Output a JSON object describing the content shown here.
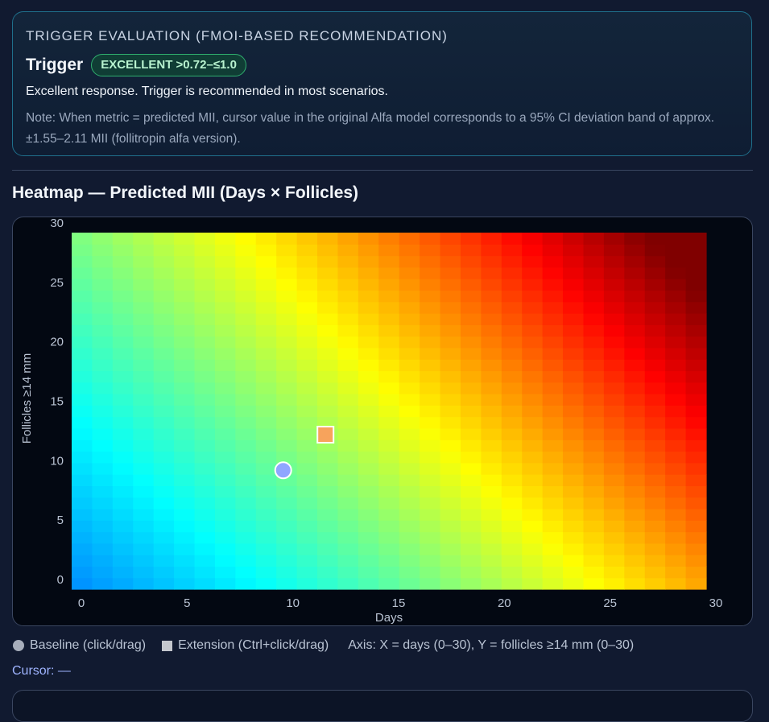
{
  "trigger_card": {
    "heading": "TRIGGER EVALUATION (FMOI-BASED RECOMMENDATION)",
    "title": "Trigger",
    "badge": "EXCELLENT >0.72–≤1.0",
    "description": "Excellent response. Trigger is recommended in most scenarios.",
    "note": "Note: When metric = predicted MII, cursor value in the original Alfa model corresponds to a 95% CI deviation band of approx. ±1.55–2.11 MII (follitropin alfa version)."
  },
  "heatmap": {
    "title": "Heatmap — Predicted MII (Days × Follicles)"
  },
  "chart_data": {
    "type": "heatmap",
    "title": "",
    "xlabel": "Days",
    "ylabel": "Follicles ≥14 mm",
    "xlim": [
      0,
      30
    ],
    "ylim": [
      0,
      30
    ],
    "x_ticks": [
      "0",
      "5",
      "10",
      "15",
      "20",
      "25",
      "30"
    ],
    "y_ticks": [
      "0",
      "5",
      "10",
      "15",
      "20",
      "25",
      "30"
    ],
    "colormap": "jet",
    "grid": false,
    "markers": [
      {
        "name": "Baseline",
        "shape": "circle",
        "x": 10,
        "y": 10,
        "color": "#8fa6ff"
      },
      {
        "name": "Extension",
        "shape": "square",
        "x": 12,
        "y": 13,
        "color": "#f7a35c"
      }
    ]
  },
  "legend": {
    "baseline": "Baseline (click/drag)",
    "extension": "Extension (Ctrl+click/drag)",
    "axis_note": "Axis: X = days (0–30), Y = follicles ≥14 mm (0–30)"
  },
  "cursor": {
    "text": "Cursor: —"
  },
  "colors": {
    "background": "#111a30",
    "card_border": "#1f6f8b",
    "badge_border": "#2fae6e",
    "badge_text": "#b8f2cf",
    "cursor_text": "#9fb4ff"
  }
}
